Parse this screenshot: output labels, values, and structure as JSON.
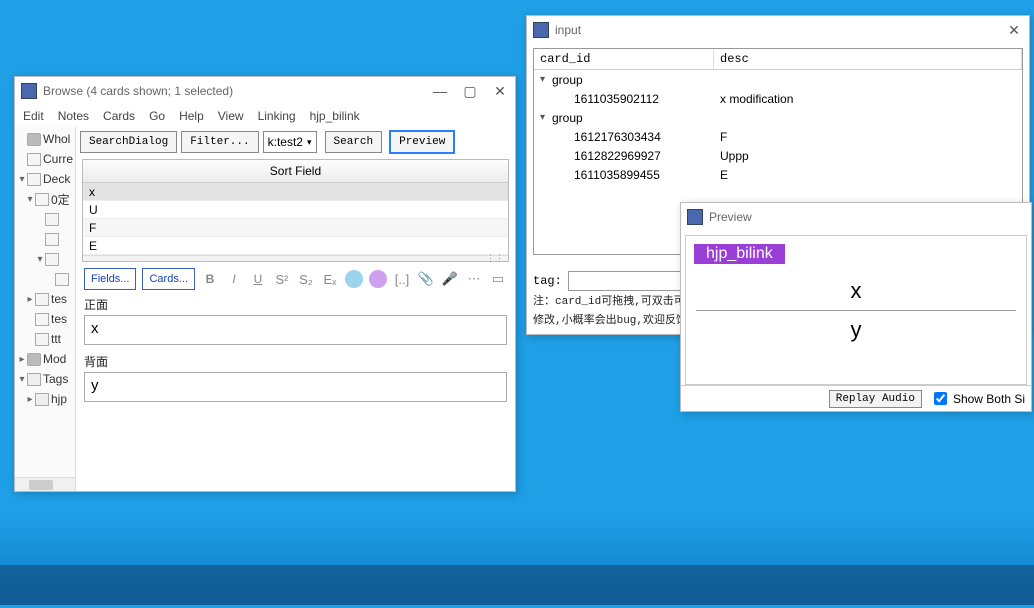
{
  "browse": {
    "title": "Browse (4 cards shown; 1 selected)",
    "menus": [
      "Edit",
      "Notes",
      "Cards",
      "Go",
      "Help",
      "View",
      "Linking",
      "hjp_bilink"
    ],
    "toolbar": {
      "searchdialog": "SearchDialog",
      "filter": "Filter...",
      "deckcombo": "k:test2",
      "search": "Search",
      "preview": "Preview"
    },
    "tree": [
      {
        "t": "Whol",
        "icon": "gear",
        "ind": 0,
        "tw": ""
      },
      {
        "t": "Curre",
        "icon": "deck",
        "ind": 0,
        "tw": ""
      },
      {
        "t": "Deck",
        "icon": "deck",
        "ind": 0,
        "tw": "v"
      },
      {
        "t": "0定",
        "icon": "deck",
        "ind": 1,
        "tw": "v"
      },
      {
        "t": "",
        "icon": "deck",
        "ind": 2,
        "tw": ""
      },
      {
        "t": "",
        "icon": "deck",
        "ind": 2,
        "tw": ""
      },
      {
        "t": "",
        "icon": "deck",
        "ind": 2,
        "tw": "v"
      },
      {
        "t": "",
        "icon": "deck",
        "ind": 3,
        "tw": ""
      },
      {
        "t": "tes",
        "icon": "deck",
        "ind": 1,
        "tw": ">"
      },
      {
        "t": "tes",
        "icon": "deck",
        "ind": 1,
        "tw": ""
      },
      {
        "t": "ttt",
        "icon": "deck",
        "ind": 1,
        "tw": ""
      },
      {
        "t": "Mod",
        "icon": "gear",
        "ind": 0,
        "tw": ">"
      },
      {
        "t": "Tags",
        "icon": "tag",
        "ind": 0,
        "tw": "v"
      },
      {
        "t": "hjp",
        "icon": "tag",
        "ind": 1,
        "tw": ">"
      }
    ],
    "grid": {
      "header": "Sort Field",
      "rows": [
        "x",
        "U",
        "F",
        "E"
      ]
    },
    "editor": {
      "fields_btn": "Fields...",
      "cards_btn": "Cards...",
      "front_label": "正面",
      "front_value": "x",
      "back_label": "背面",
      "back_value": "y"
    }
  },
  "input": {
    "title": "input",
    "columns": [
      "card_id",
      "desc"
    ],
    "rows": [
      {
        "type": "group",
        "label": "group"
      },
      {
        "type": "child",
        "id": "1611035902112",
        "desc": "x modification"
      },
      {
        "type": "group",
        "label": "group"
      },
      {
        "type": "child",
        "id": "1612176303434",
        "desc": "F"
      },
      {
        "type": "child",
        "id": "1612822969927",
        "desc": "Uppp"
      },
      {
        "type": "child",
        "id": "1611035899455",
        "desc": "E"
      }
    ],
    "tag_label": "tag:",
    "tag_value": "",
    "note_l1": "注：card_id可拖拽,可双击可右键,两个视图均可直接在对应的项目上修改",
    "note_l2": "修改,小概率会出bug,欢迎反馈"
  },
  "preview": {
    "title": "Preview",
    "badge": "hjp_bilink",
    "front": "x",
    "back": "y",
    "replay": "Replay Audio",
    "showboth": "Show Both Si",
    "showboth_checked": true
  }
}
